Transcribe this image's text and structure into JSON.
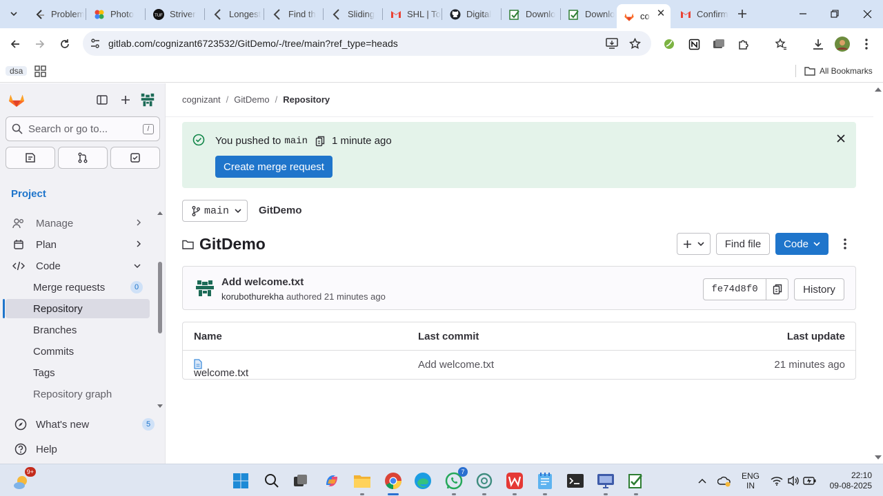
{
  "browser": {
    "tabs": [
      {
        "title": "Problem",
        "favicon": "leetcode-icon"
      },
      {
        "title": "Photo",
        "favicon": "google-photos-icon"
      },
      {
        "title": "Striver",
        "favicon": "tuf-icon"
      },
      {
        "title": "Longest",
        "favicon": "bracket-icon"
      },
      {
        "title": "Find th",
        "favicon": "bracket-icon"
      },
      {
        "title": "Sliding",
        "favicon": "bracket-icon"
      },
      {
        "title": "SHL | To",
        "favicon": "gmail-icon"
      },
      {
        "title": "Digital",
        "favicon": "github-icon"
      },
      {
        "title": "Downlo",
        "favicon": "form-icon"
      },
      {
        "title": "Downlo",
        "favicon": "form-icon"
      },
      {
        "title": "co",
        "favicon": "gitlab-icon",
        "active": true
      },
      {
        "title": "Confirm",
        "favicon": "gmail-icon"
      }
    ],
    "url": "gitlab.com/cognizant6723532/GitDemo/-/tree/main?ref_type=heads",
    "bookmarks": {
      "folder_chip": "dsa",
      "all_bookmarks": "All Bookmarks"
    }
  },
  "sidebar": {
    "search_placeholder": "Search or go to...",
    "search_shortcut": "/",
    "section_title": "Project",
    "items": [
      {
        "label": "Manage",
        "type": "group",
        "expanded": false
      },
      {
        "label": "Plan",
        "type": "group",
        "expanded": false
      },
      {
        "label": "Code",
        "type": "group",
        "expanded": true
      },
      {
        "label": "Merge requests",
        "type": "sub",
        "count": "0"
      },
      {
        "label": "Repository",
        "type": "sub",
        "active": true
      },
      {
        "label": "Branches",
        "type": "sub"
      },
      {
        "label": "Commits",
        "type": "sub"
      },
      {
        "label": "Tags",
        "type": "sub"
      },
      {
        "label": "Repository graph",
        "type": "sub"
      }
    ],
    "whats_new": {
      "label": "What's new",
      "count": "5"
    },
    "help": {
      "label": "Help"
    }
  },
  "breadcrumb": [
    "cognizant",
    "GitDemo",
    "Repository"
  ],
  "alert": {
    "prefix": "You pushed to",
    "branch": "main",
    "time": "1 minute ago",
    "button": "Create merge request"
  },
  "repo": {
    "branch": "main",
    "path": "GitDemo",
    "title": "GitDemo",
    "find_file": "Find file",
    "code_button": "Code"
  },
  "last_commit": {
    "title": "Add welcome.txt",
    "author": "korubothurekha",
    "action": "authored",
    "time": "21 minutes ago",
    "sha": "fe74d8f0",
    "history": "History"
  },
  "files_table": {
    "headers": [
      "Name",
      "Last commit",
      "Last update"
    ],
    "rows": [
      {
        "name": "welcome.txt",
        "commit": "Add welcome.txt",
        "updated": "21 minutes ago"
      }
    ]
  },
  "taskbar": {
    "weather_badge": "9+",
    "whatsapp_badge": "7",
    "lang_top": "ENG",
    "lang_bottom": "IN",
    "time": "22:10",
    "date": "09-08-2025"
  },
  "colors": {
    "accent": "#1f75cb",
    "alert_bg": "#e4f3ea",
    "gitlab_orange": "#fc6d26"
  }
}
